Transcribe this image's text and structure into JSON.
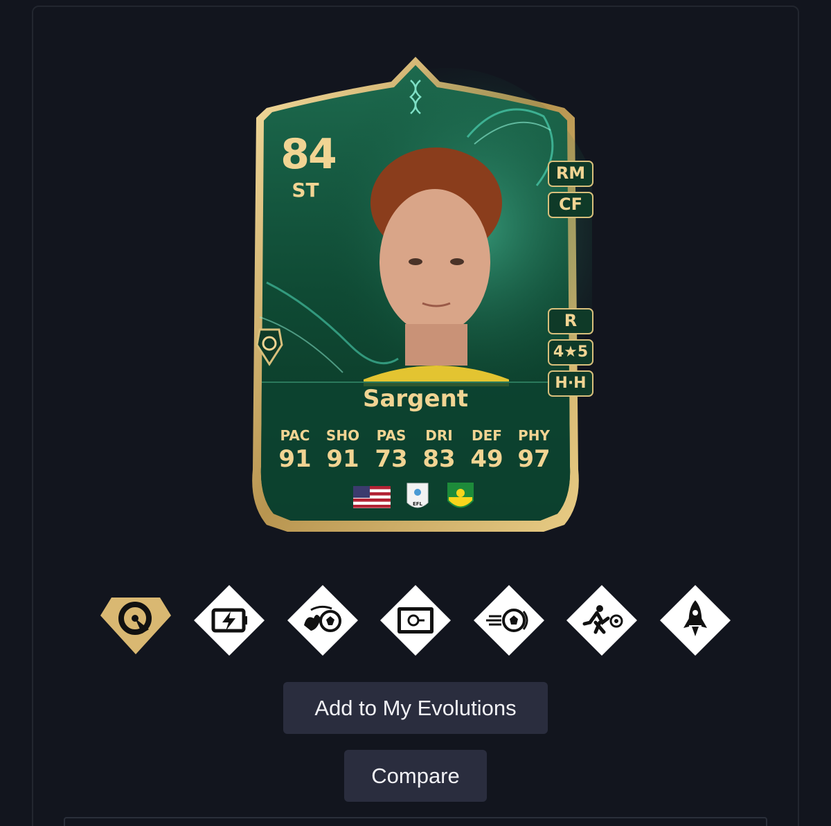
{
  "card": {
    "rating": "84",
    "position": "ST",
    "alt_positions": [
      "RM",
      "CF"
    ],
    "preferred_foot": "R",
    "skill_weak": "4★5",
    "work_rates": "H·H",
    "name": "Sargent",
    "stats": [
      {
        "label": "PAC",
        "value": "91"
      },
      {
        "label": "SHO",
        "value": "91"
      },
      {
        "label": "PAS",
        "value": "73"
      },
      {
        "label": "DRI",
        "value": "83"
      },
      {
        "label": "DEF",
        "value": "49"
      },
      {
        "label": "PHY",
        "value": "97"
      }
    ],
    "league_badge_text": "EFL",
    "colors": {
      "gold": "#f1d493",
      "card_green": "#0f3a28"
    }
  },
  "playstyles": [
    {
      "icon": "ram-head-icon",
      "plus": true
    },
    {
      "icon": "battery-bolt-icon",
      "plus": false
    },
    {
      "icon": "hand-ball-icon",
      "plus": false
    },
    {
      "icon": "safe-box-icon",
      "plus": false
    },
    {
      "icon": "power-shot-icon",
      "plus": false
    },
    {
      "icon": "runner-ball-icon",
      "plus": false
    },
    {
      "icon": "rocket-icon",
      "plus": false
    }
  ],
  "actions": {
    "add_label": "Add to My Evolutions",
    "compare_label": "Compare"
  }
}
